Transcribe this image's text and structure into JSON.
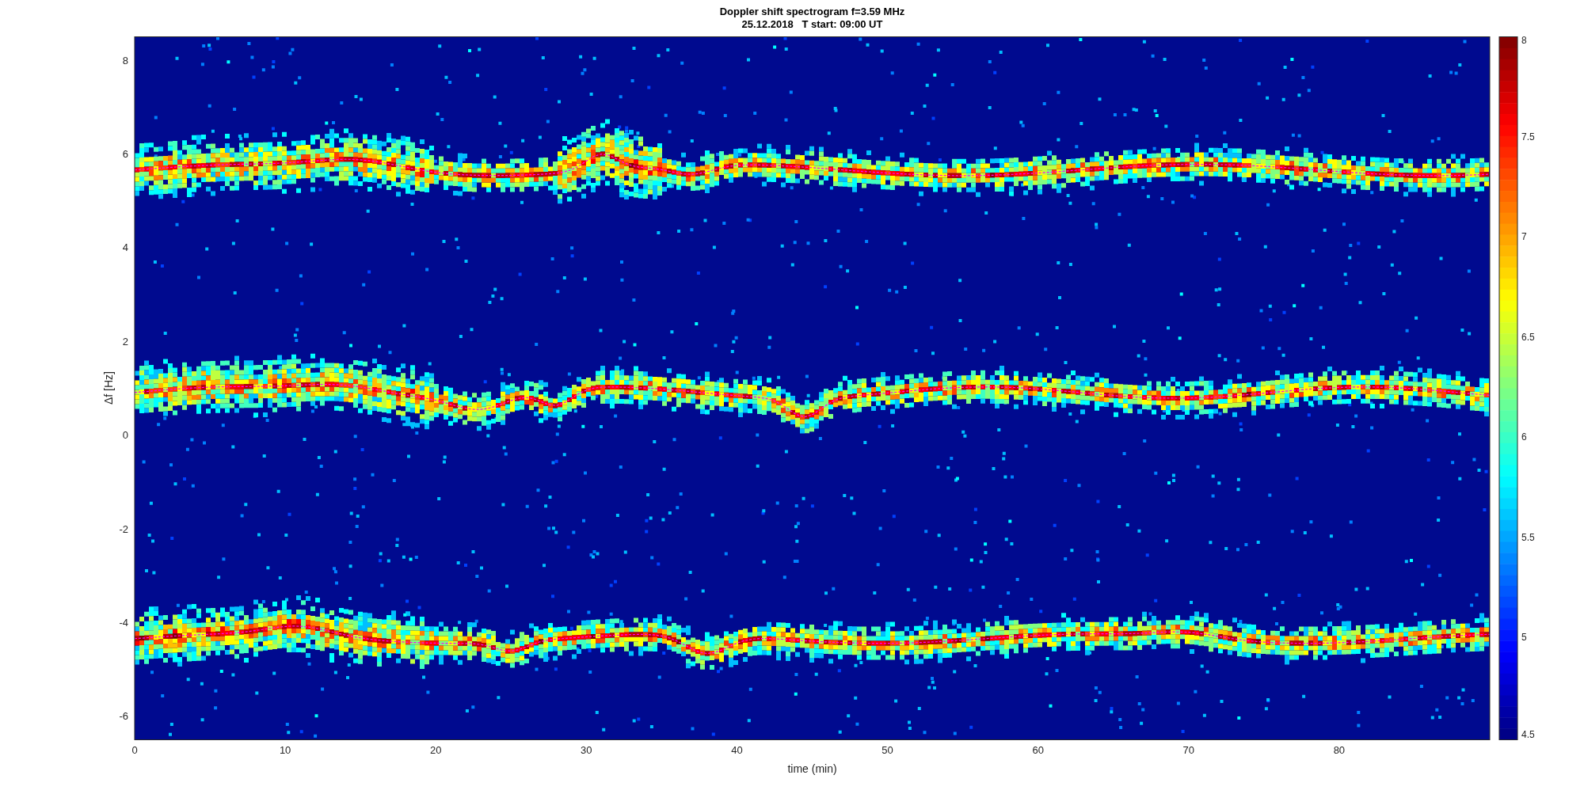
{
  "figure": {
    "title": "Doppler shift spectrogram f=3.59 MHz",
    "subtitle": "25.12.2018   T start: 09:00 UT"
  },
  "axes": {
    "xlabel": "time (min)",
    "ylabel": "Δf [Hz]",
    "xticks": [
      "0",
      "10",
      "20",
      "30",
      "40",
      "50",
      "60",
      "70",
      "80"
    ],
    "yticks": [
      "8",
      "6",
      "4",
      "2",
      "0",
      "-2",
      "-4",
      "-6"
    ]
  },
  "colorbar": {
    "ticks": [
      "8",
      "7.5",
      "7",
      "6.5",
      "6",
      "5.5",
      "5",
      "4.5"
    ]
  }
}
